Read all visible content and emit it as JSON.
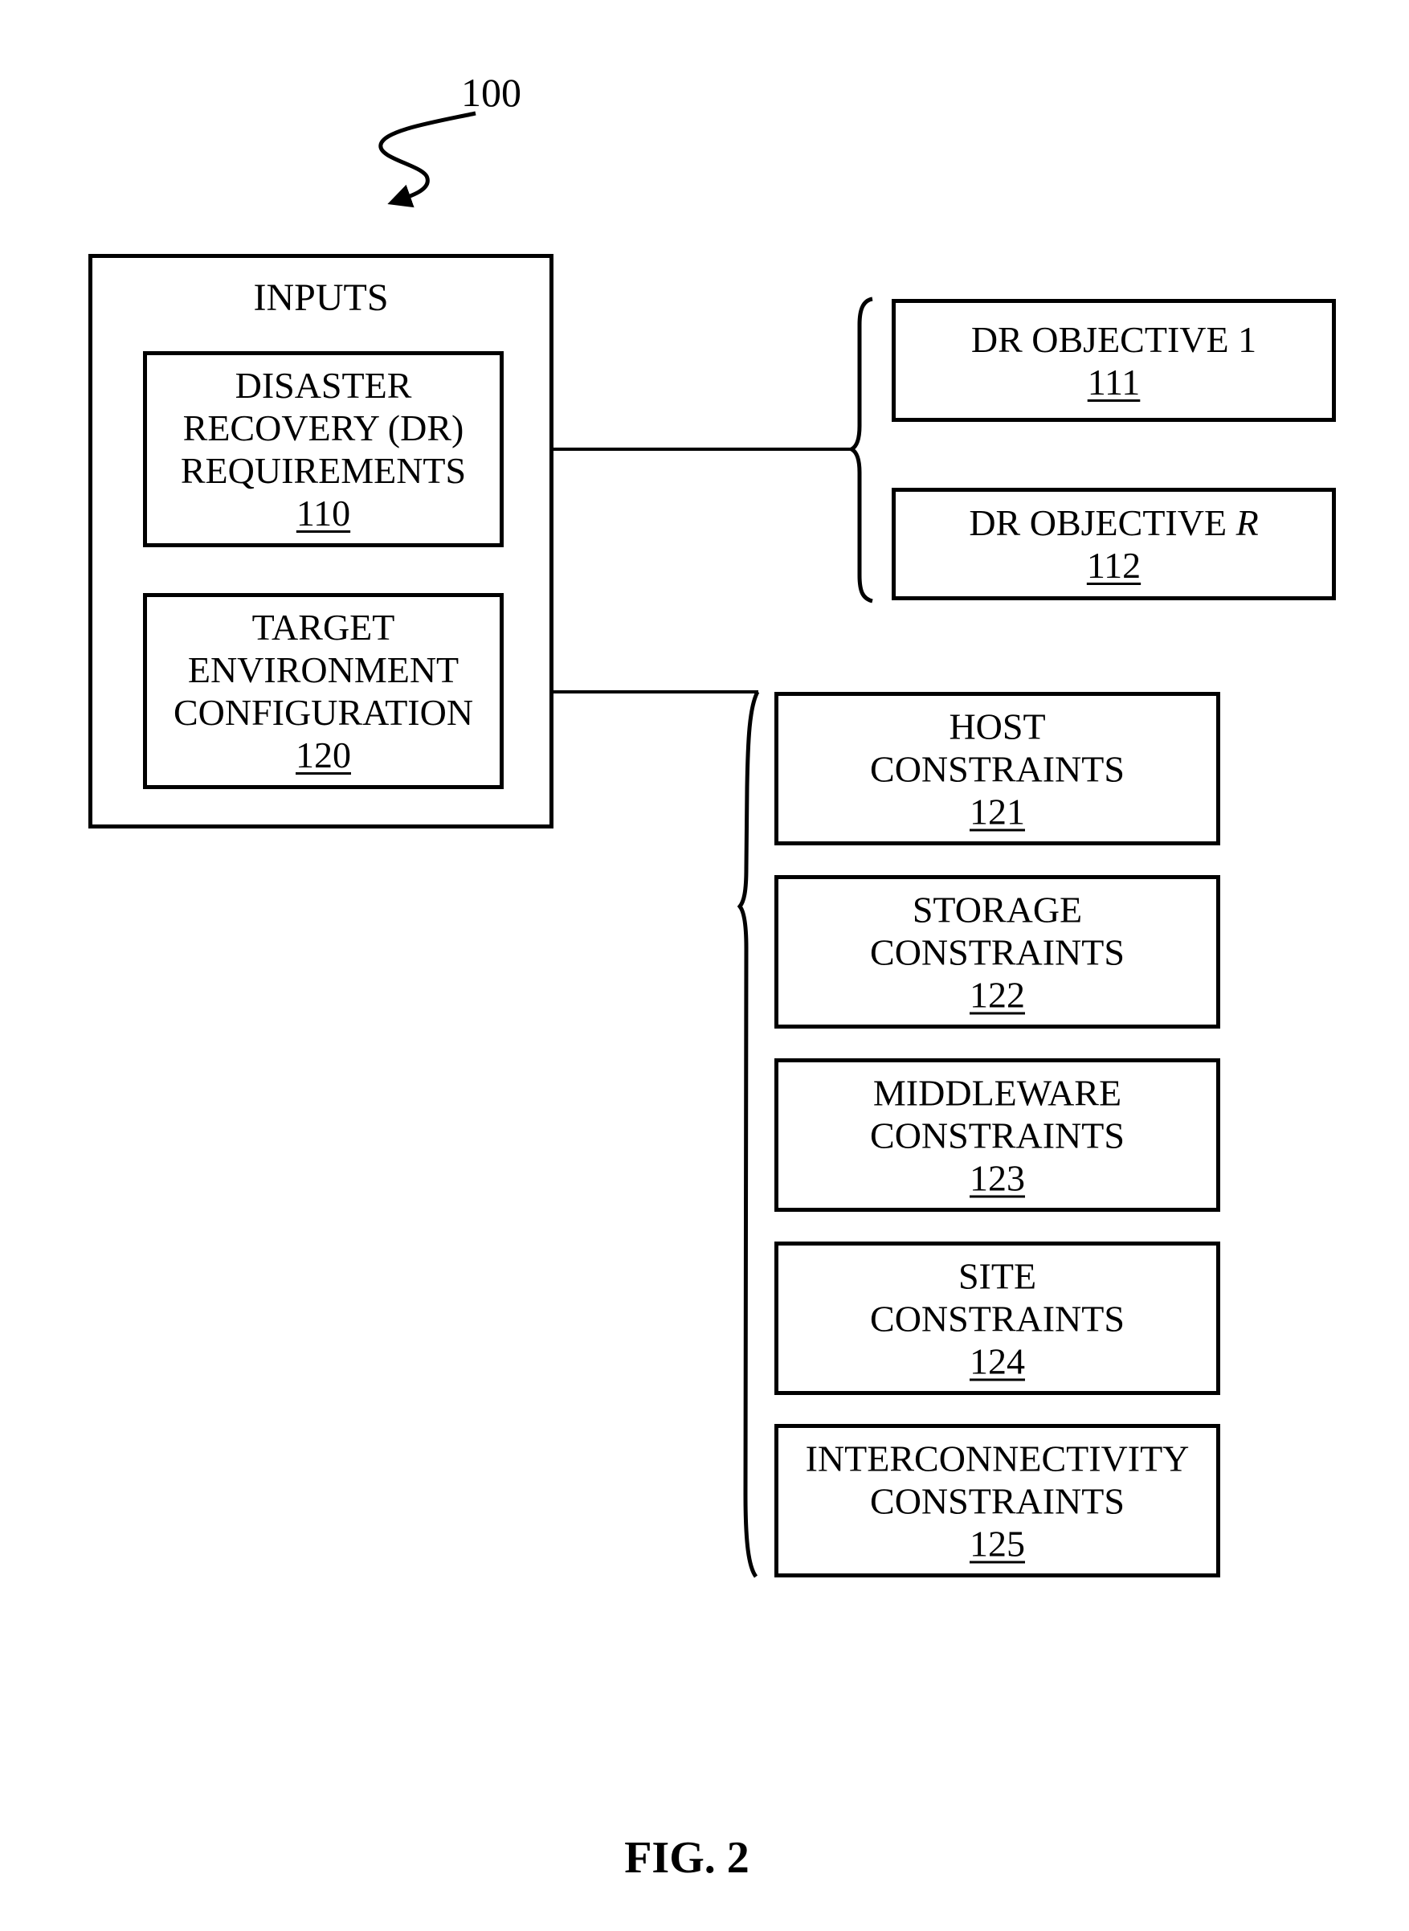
{
  "figure": {
    "reference_number": "100",
    "caption": "FIG. 2"
  },
  "inputs": {
    "title": "INPUTS",
    "items": [
      {
        "lines": [
          "DISASTER",
          "RECOVERY (DR)",
          "REQUIREMENTS"
        ],
        "ref": "110"
      },
      {
        "lines": [
          "TARGET",
          "ENVIRONMENT",
          "CONFIGURATION"
        ],
        "ref": "120"
      }
    ]
  },
  "dr_objectives": [
    {
      "text": "DR OBJECTIVE ",
      "italic_suffix": "",
      "plain_suffix": "1",
      "ref": "111"
    },
    {
      "text": "DR OBJECTIVE ",
      "italic_suffix": "R",
      "plain_suffix": "",
      "ref": "112"
    }
  ],
  "constraints": [
    {
      "lines": [
        "HOST",
        "CONSTRAINTS"
      ],
      "ref": "121"
    },
    {
      "lines": [
        "STORAGE",
        "CONSTRAINTS"
      ],
      "ref": "122"
    },
    {
      "lines": [
        "MIDDLEWARE",
        "CONSTRAINTS"
      ],
      "ref": "123"
    },
    {
      "lines": [
        "SITE",
        "CONSTRAINTS"
      ],
      "ref": "124"
    },
    {
      "lines": [
        "INTERCONNECTIVITY",
        "CONSTRAINTS"
      ],
      "ref": "125"
    }
  ]
}
